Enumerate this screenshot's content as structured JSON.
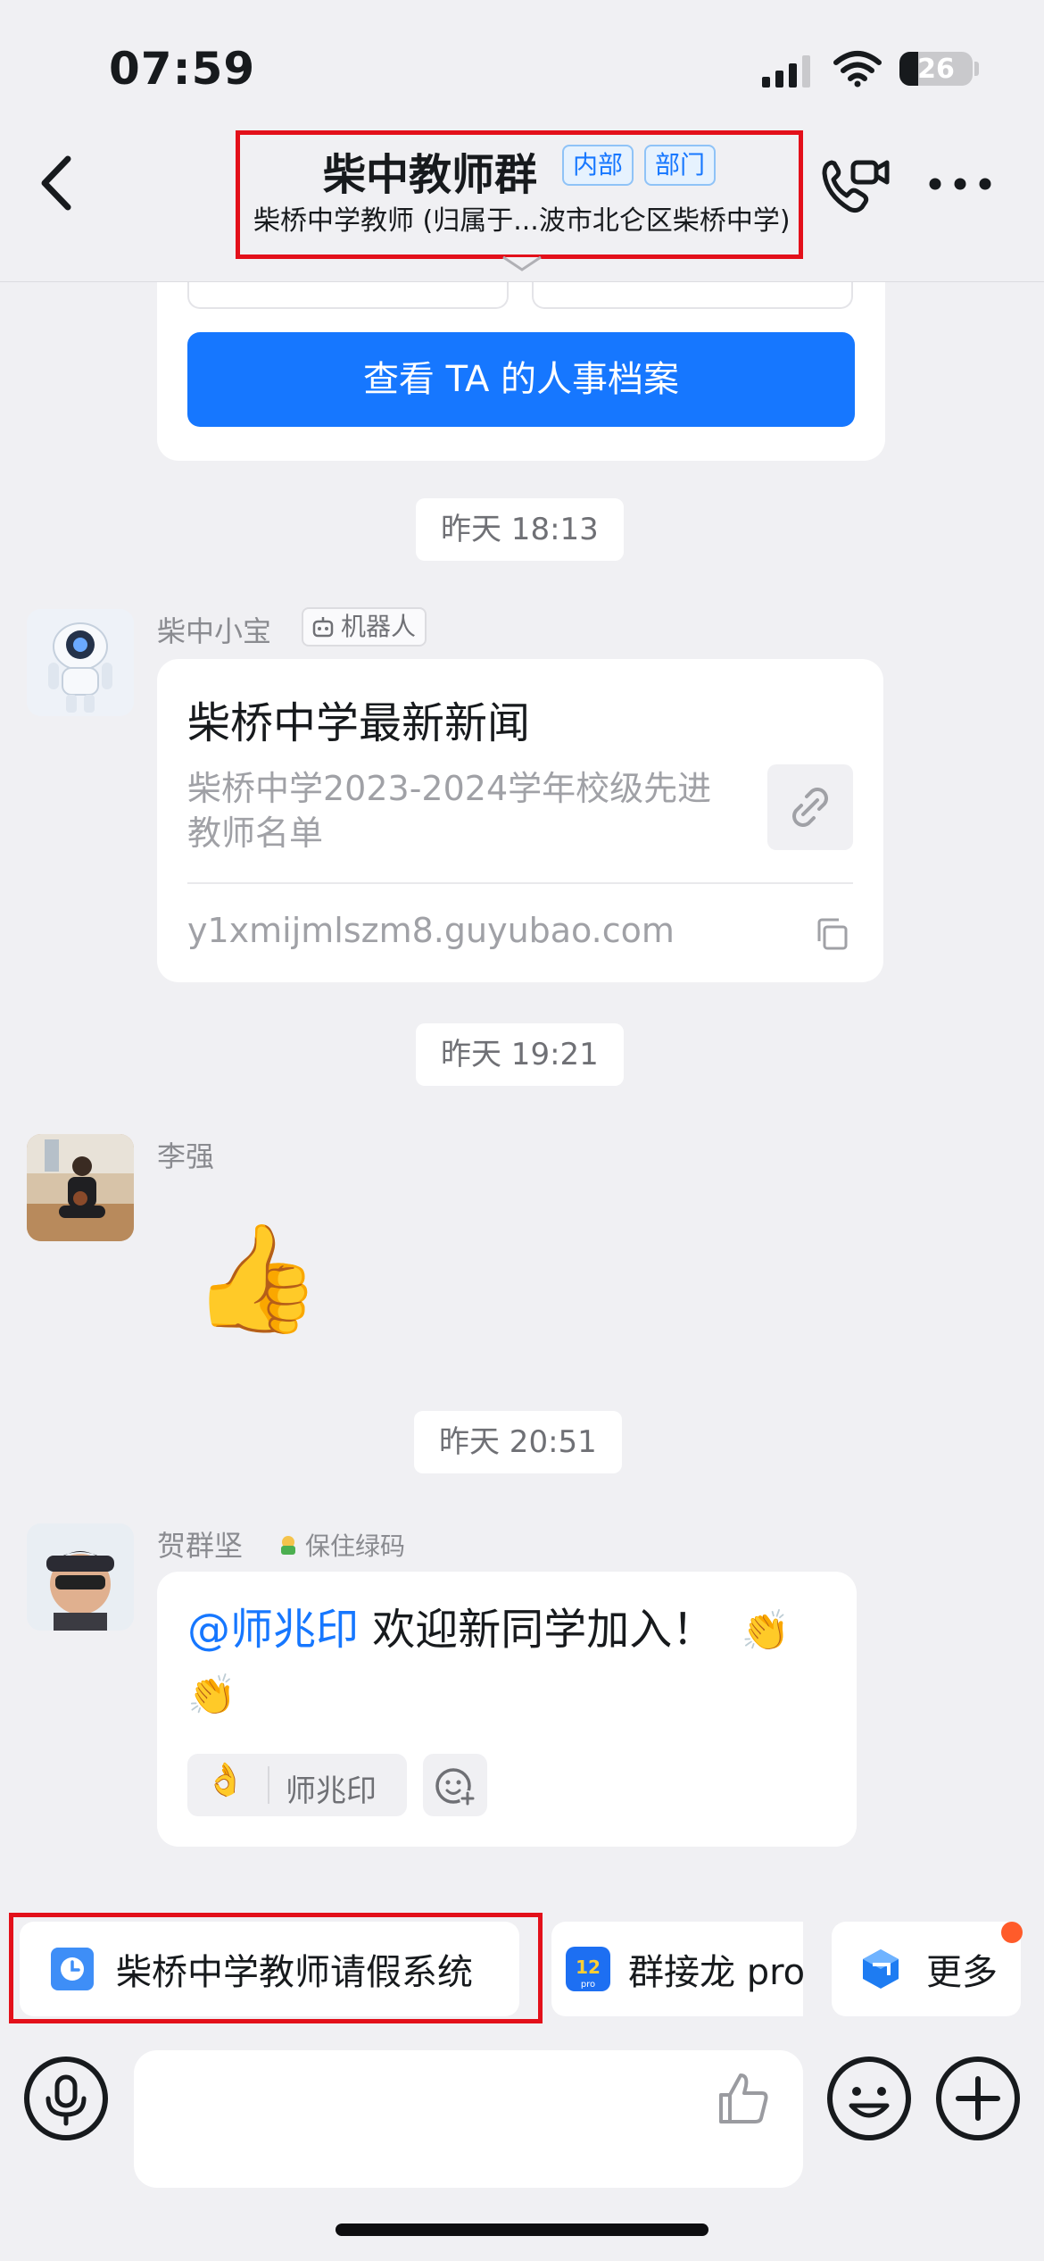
{
  "status_bar": {
    "time": "07:59",
    "battery": "26",
    "battery_level": 0.26
  },
  "header": {
    "title": "柴中教师群",
    "tags": [
      "内部",
      "部门"
    ],
    "subtitle": "柴桥中学教师 (归属于...波市北仑区柴桥中学)"
  },
  "card_prev": {
    "button_label": "查看 TA 的人事档案"
  },
  "messages": [
    {
      "time": "昨天 18:13"
    },
    {
      "sender": "柴中小宝",
      "badge": "机器人",
      "news_title": "柴桥中学最新新闻",
      "news_desc": "柴桥中学2023-2024学年校级先进教师名单",
      "news_url": "y1xmijmlszm8.guyubao.com"
    },
    {
      "time": "昨天 19:21"
    },
    {
      "sender": "李强",
      "sticker": "👍"
    },
    {
      "time": "昨天 20:51"
    },
    {
      "sender": "贺群坚",
      "status": "保住绿码",
      "mention": "@师兆印",
      "text": " 欢迎新同学加入！",
      "emoji": "👏",
      "reaction_emoji": "👌",
      "reaction_name": "师兆印"
    }
  ],
  "quick_apps": [
    {
      "label": "柴桥中学教师请假系统",
      "icon": "clock-icon"
    },
    {
      "label": "群接龙 pro",
      "icon": "jielong-app-icon"
    },
    {
      "label": "更多",
      "icon": "more-apps-icon"
    }
  ],
  "colors": {
    "accent": "#1677ff",
    "highlight_box": "#e3101a",
    "badge": "#ff5b2a"
  }
}
